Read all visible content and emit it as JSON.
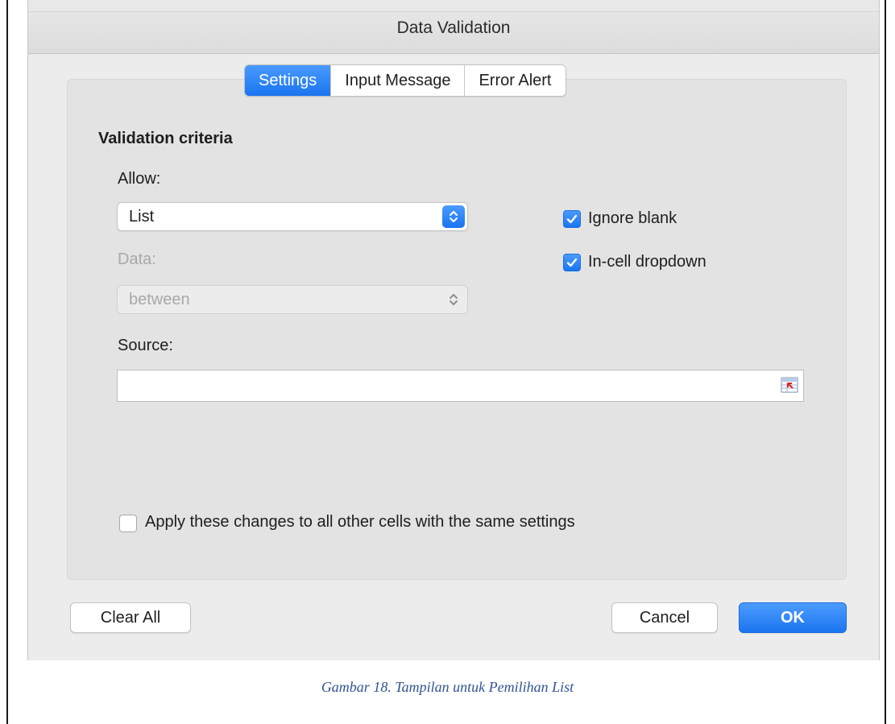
{
  "dialog": {
    "title": "Data Validation",
    "tabs": [
      {
        "label": "Settings",
        "active": true
      },
      {
        "label": "Input Message",
        "active": false
      },
      {
        "label": "Error Alert",
        "active": false
      }
    ]
  },
  "settings": {
    "section_heading": "Validation criteria",
    "allow_label": "Allow:",
    "allow_value": "List",
    "data_label": "Data:",
    "data_value": "between",
    "ignore_blank_label": "Ignore blank",
    "ignore_blank_checked": true,
    "in_cell_dropdown_label": "In-cell dropdown",
    "in_cell_dropdown_checked": true,
    "source_label": "Source:",
    "source_value": "",
    "apply_all_label": "Apply these changes to all other cells with the same settings",
    "apply_all_checked": false
  },
  "buttons": {
    "clear_all": "Clear All",
    "cancel": "Cancel",
    "ok": "OK"
  },
  "caption": "Gambar 18. Tampilan untuk Pemilihan List",
  "icons": [
    "chevron-up-down-icon",
    "checkmark-icon",
    "range-selector-icon"
  ],
  "colors": {
    "accent": "#1a74f0",
    "caption": "#2f5496"
  }
}
